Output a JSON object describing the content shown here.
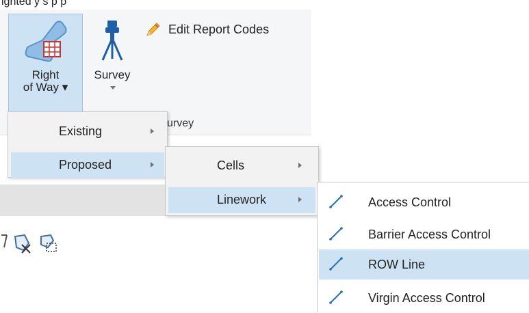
{
  "ribbon": {
    "right_of_way": {
      "line1": "Right",
      "line2": "of Way ▾"
    },
    "survey": {
      "label": "Survey"
    },
    "edit_report_codes": {
      "label": "Edit Report Codes"
    },
    "group_label": "urvey"
  },
  "menu_level1": {
    "items": [
      {
        "label": "Existing"
      },
      {
        "label": "Proposed"
      }
    ]
  },
  "menu_level2": {
    "items": [
      {
        "label": "Cells"
      },
      {
        "label": "Linework"
      }
    ]
  },
  "menu_level3": {
    "items": [
      {
        "label": "Access Control"
      },
      {
        "label": "Barrier Access Control"
      },
      {
        "label": "ROW Line"
      },
      {
        "label": "Virgin Access Control"
      }
    ]
  },
  "colors": {
    "highlight": "#cde3f4",
    "line_icon": "#2a6fb0",
    "menu_bg": "#f2f2f2"
  },
  "icons": [
    "right-of-way-icon",
    "survey-tripod-icon",
    "pencil-icon",
    "submenu-arrow-icon",
    "line-tool-icon"
  ]
}
